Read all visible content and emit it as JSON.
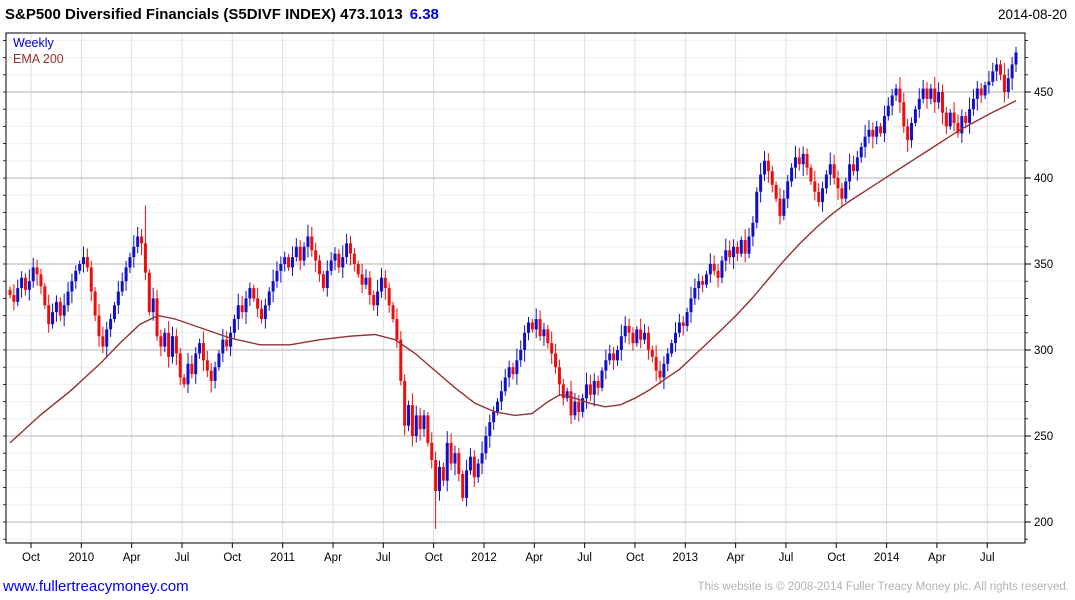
{
  "header": {
    "title_main": "S&P500 Diversified Financials (S5DIVF INDEX) 473.1013",
    "title_change": "6.38",
    "date": "2014-08-20"
  },
  "legend": {
    "series_label": "Weekly",
    "overlay_label": "EMA 200"
  },
  "footer": {
    "link": "www.fullertreacymoney.com",
    "copyright": "This website is © 2008-2014 Fuller Treacy Money plc. All rights reserved."
  },
  "chart_data": {
    "type": "candlestick",
    "interval": "weekly",
    "title": "S&P500 Diversified Financials (S5DIVF INDEX)",
    "last_price": 473.1013,
    "change": 6.38,
    "ylim": [
      188,
      484
    ],
    "y_ticks": [
      450,
      400,
      350,
      300,
      250,
      200
    ],
    "y_minor_step": 10,
    "x_tick_labels": [
      "Oct",
      "2010",
      "Apr",
      "Jul",
      "Oct",
      "2011",
      "Apr",
      "Jul",
      "Oct",
      "2012",
      "Apr",
      "Jul",
      "Oct",
      "2013",
      "Apr",
      "Jul",
      "Oct",
      "2014",
      "Apr",
      "Jul"
    ],
    "grid": {
      "vertical": true,
      "horizontal_major": true,
      "horizontal_minor": true
    },
    "legend_position": "top-left",
    "closes": [
      332,
      328,
      336,
      342,
      335,
      340,
      348,
      344,
      337,
      326,
      315,
      322,
      328,
      320,
      326,
      334,
      340,
      346,
      350,
      354,
      348,
      334,
      320,
      308,
      302,
      312,
      318,
      326,
      334,
      340,
      348,
      354,
      360,
      366,
      362,
      345,
      322,
      330,
      308,
      302,
      310,
      296,
      308,
      298,
      284,
      280,
      292,
      286,
      298,
      304,
      294,
      288,
      282,
      290,
      298,
      306,
      302,
      310,
      318,
      326,
      322,
      330,
      336,
      330,
      324,
      318,
      326,
      334,
      340,
      346,
      350,
      354,
      348,
      354,
      360,
      352,
      360,
      366,
      358,
      352,
      344,
      336,
      346,
      352,
      356,
      348,
      354,
      362,
      356,
      350,
      344,
      338,
      342,
      332,
      326,
      334,
      342,
      336,
      326,
      318,
      306,
      282,
      256,
      268,
      250,
      262,
      254,
      262,
      246,
      236,
      218,
      232,
      224,
      246,
      234,
      240,
      228,
      214,
      230,
      238,
      226,
      234,
      240,
      250,
      258,
      264,
      270,
      276,
      284,
      290,
      286,
      294,
      300,
      310,
      316,
      312,
      318,
      308,
      312,
      304,
      298,
      290,
      280,
      272,
      276,
      262,
      270,
      264,
      272,
      280,
      274,
      282,
      278,
      288,
      294,
      298,
      294,
      300,
      308,
      314,
      310,
      304,
      312,
      306,
      310,
      300,
      296,
      288,
      284,
      292,
      298,
      304,
      310,
      316,
      314,
      322,
      330,
      336,
      340,
      338,
      344,
      350,
      346,
      342,
      352,
      358,
      354,
      360,
      356,
      364,
      356,
      366,
      374,
      392,
      402,
      410,
      404,
      396,
      388,
      378,
      388,
      398,
      406,
      412,
      408,
      414,
      406,
      398,
      392,
      386,
      394,
      402,
      408,
      400,
      394,
      388,
      398,
      408,
      404,
      412,
      418,
      424,
      428,
      424,
      430,
      426,
      436,
      442,
      448,
      452,
      444,
      430,
      422,
      432,
      440,
      446,
      452,
      446,
      452,
      444,
      450,
      438,
      430,
      438,
      432,
      426,
      436,
      432,
      440,
      446,
      452,
      448,
      454,
      456,
      462,
      466,
      460,
      450,
      458,
      466,
      473
    ],
    "overrides": {
      "0": {
        "open": 335
      },
      "35": {
        "high": 384
      },
      "110": {
        "low": 196
      }
    },
    "ema200_path": [
      [
        10,
        246
      ],
      [
        40,
        262
      ],
      [
        70,
        276
      ],
      [
        100,
        292
      ],
      [
        120,
        304
      ],
      [
        140,
        315
      ],
      [
        158,
        320
      ],
      [
        175,
        318
      ],
      [
        200,
        313
      ],
      [
        230,
        307
      ],
      [
        260,
        303
      ],
      [
        290,
        303
      ],
      [
        320,
        306
      ],
      [
        350,
        308
      ],
      [
        375,
        309
      ],
      [
        395,
        306
      ],
      [
        415,
        298
      ],
      [
        435,
        288
      ],
      [
        455,
        278
      ],
      [
        475,
        269
      ],
      [
        495,
        264
      ],
      [
        515,
        262
      ],
      [
        532,
        263
      ],
      [
        548,
        270
      ],
      [
        560,
        274
      ],
      [
        575,
        272
      ],
      [
        590,
        269
      ],
      [
        605,
        267
      ],
      [
        620,
        268
      ],
      [
        635,
        272
      ],
      [
        650,
        277
      ],
      [
        665,
        283
      ],
      [
        680,
        289
      ],
      [
        700,
        300
      ],
      [
        720,
        311
      ],
      [
        736,
        320
      ],
      [
        752,
        330
      ],
      [
        768,
        341
      ],
      [
        784,
        352
      ],
      [
        800,
        362
      ],
      [
        816,
        371
      ],
      [
        832,
        379
      ],
      [
        848,
        386
      ],
      [
        864,
        392
      ],
      [
        880,
        398
      ],
      [
        896,
        404
      ],
      [
        912,
        410
      ],
      [
        928,
        416
      ],
      [
        944,
        422
      ],
      [
        960,
        428
      ],
      [
        976,
        433
      ],
      [
        992,
        438
      ],
      [
        1006,
        442
      ],
      [
        1016,
        445
      ]
    ],
    "colors": {
      "up_candle": "#1010c8",
      "down_candle": "#ee0d0d",
      "ema_line": "#943030",
      "grid_major": "#b3b3b3",
      "grid_minor": "#eeeeee",
      "grid_vertical": "#dedede",
      "axis": "#000000"
    }
  }
}
